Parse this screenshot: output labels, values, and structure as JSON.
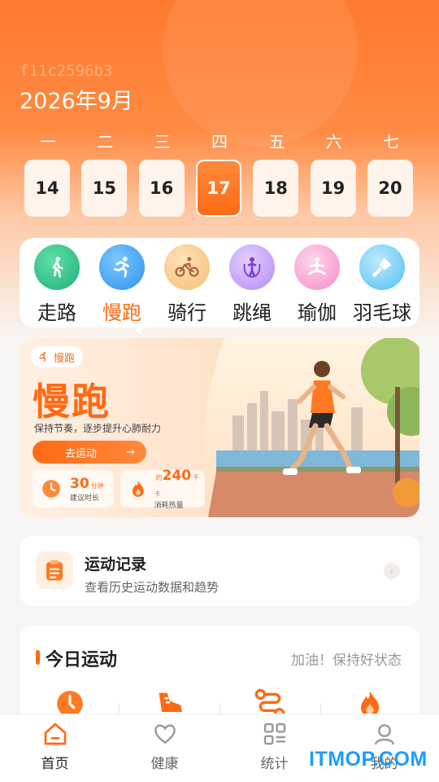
{
  "header": {
    "device_id": "f11c2596b3",
    "month": "2026年9月"
  },
  "week": {
    "labels": [
      "一",
      "二",
      "三",
      "四",
      "五",
      "六",
      "七"
    ],
    "days": [
      "14",
      "15",
      "16",
      "17",
      "18",
      "19",
      "20"
    ],
    "active_index": 3
  },
  "sports": [
    {
      "label": "走路",
      "icon": "walking-icon",
      "color": "#2bc48a"
    },
    {
      "label": "慢跑",
      "icon": "running-icon",
      "color": "#3ba7f5"
    },
    {
      "label": "骑行",
      "icon": "cycling-icon",
      "color": "#f6c17a"
    },
    {
      "label": "跳绳",
      "icon": "jump-rope-icon",
      "color": "#b28af5"
    },
    {
      "label": "瑜伽",
      "icon": "yoga-icon",
      "color": "#f58cc7"
    },
    {
      "label": "羽毛球",
      "icon": "badminton-icon",
      "color": "#4fc0f0"
    }
  ],
  "banner": {
    "tag": "慢跑",
    "title": "慢跑",
    "subtitle": "保持节奏，逐步提升心肺耐力",
    "button": "去运动",
    "duration_value": "30",
    "duration_unit": "分钟",
    "duration_caption": "建议时长",
    "calorie_prefix": "约",
    "calorie_value": "240",
    "calorie_unit": "千卡",
    "calorie_caption": "消耗热量"
  },
  "record": {
    "title": "运动记录",
    "subtitle": "查看历史运动数据和趋势"
  },
  "today": {
    "title": "今日运动",
    "hint": "加油！保持好状态",
    "icons": [
      "clock-icon",
      "shoe-icon",
      "route-icon",
      "flame-icon"
    ]
  },
  "tabs": [
    {
      "label": "首页",
      "icon": "home-icon"
    },
    {
      "label": "健康",
      "icon": "heart-icon"
    },
    {
      "label": "统计",
      "icon": "stats-icon"
    },
    {
      "label": "我的",
      "icon": "profile-icon"
    }
  ],
  "active_tab": 0,
  "watermark": "ITMOP.COM",
  "colors": {
    "accent": "#ff6a14",
    "watermark": "#1e9cff"
  }
}
